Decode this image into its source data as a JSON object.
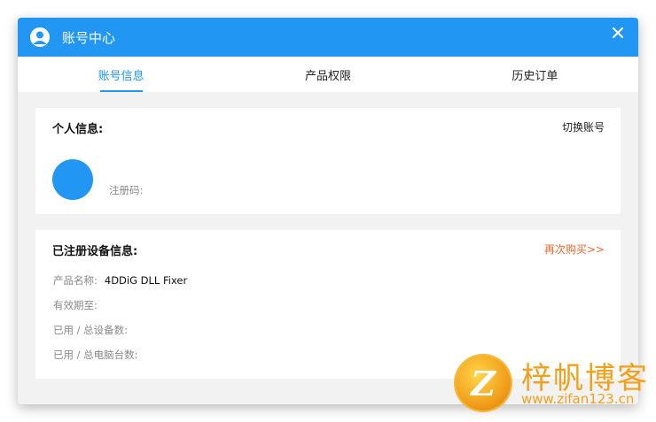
{
  "window": {
    "title": "账号中心",
    "close_icon": "close-icon",
    "accent_color": "#2196f3"
  },
  "tabs": [
    {
      "label": "账号信息",
      "active": true
    },
    {
      "label": "产品权限",
      "active": false
    },
    {
      "label": "历史订单",
      "active": false
    }
  ],
  "personal_info": {
    "title": "个人信息:",
    "switch_account": "切换账号",
    "registration_label": "注册码:"
  },
  "device_info": {
    "title": "已注册设备信息:",
    "buy_again": "再次购买>>",
    "buy_color": "#e8672a",
    "product_name_label": "产品名称:",
    "product_name_value": "4DDiG DLL Fixer",
    "expiry_label": "有效期至:",
    "devices_label": "已用 / 总设备数:",
    "computers_label": "已用 / 总电脑台数:"
  },
  "watermark": {
    "logo_letter": "Z",
    "title": "梓帆博客",
    "url": "www.zifan123.cn"
  }
}
